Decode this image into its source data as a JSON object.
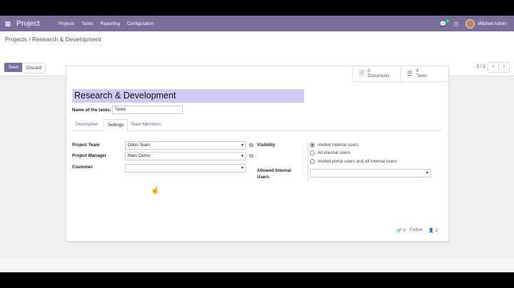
{
  "navbar": {
    "app_name": "Project",
    "menu": [
      "Projects",
      "Tasks",
      "Reporting",
      "Configuration"
    ],
    "chat_count": "1",
    "user_name": "Mitchell Admin"
  },
  "breadcrumb": {
    "parent": "Projects",
    "separator": " / ",
    "current": "Research & Development"
  },
  "buttons": {
    "save": "Save",
    "discard": "Discard"
  },
  "pager": {
    "value": "2 / 2",
    "prev": "‹",
    "next": "›"
  },
  "smart_buttons": [
    {
      "count": "0",
      "label": "Documents",
      "icon": "document-icon"
    },
    {
      "count": "8",
      "label": "Tasks",
      "icon": "tasks-icon"
    }
  ],
  "form": {
    "title": "Research & Development",
    "tasks_label": "Name of the tasks:",
    "tasks_value": "Tasks"
  },
  "tabs": [
    "Description",
    "Settings",
    "Team Members"
  ],
  "settings": {
    "project_team_label": "Project Team",
    "project_team_value": "Odoo Team",
    "project_manager_label": "Project Manager",
    "project_manager_value": "Marc Demo",
    "customer_label": "Customer",
    "customer_value": "",
    "visibility_label": "Visibility",
    "visibility_options": [
      "Invited internal users",
      "All internal users",
      "Invited portal users and all internal users"
    ],
    "allowed_label_1": "Allowed Internal",
    "allowed_label_2": "Users"
  },
  "chatter": {
    "attachments": "0",
    "follow": "Follow",
    "followers": "2"
  },
  "colors": {
    "navbar": "#7a6f9c",
    "title_highlight": "#cfcaf2",
    "badge": "#21b799"
  }
}
